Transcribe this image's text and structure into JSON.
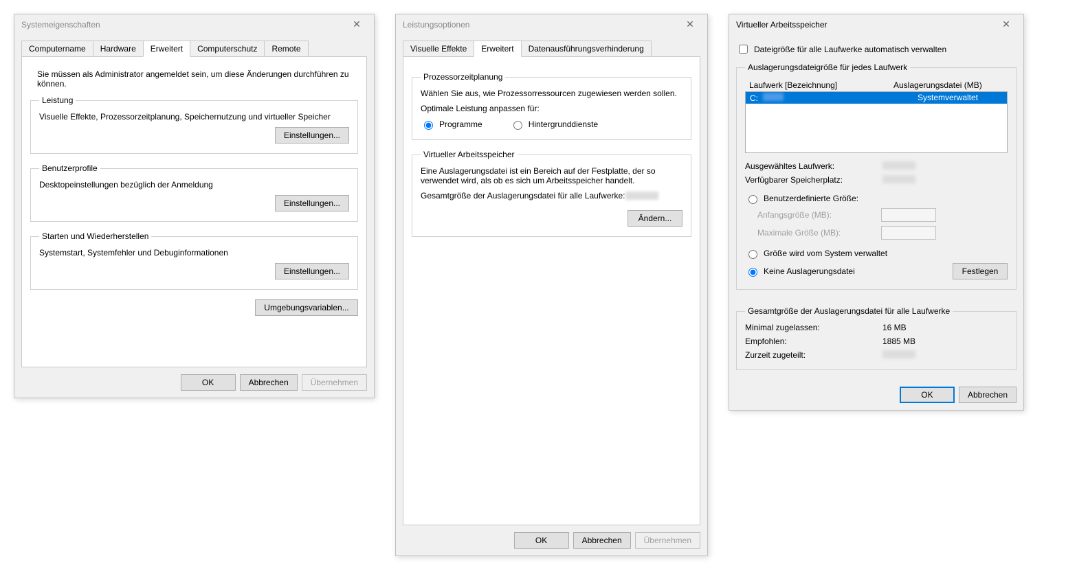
{
  "dlg1": {
    "title": "Systemeigenschaften",
    "tabs": [
      "Computername",
      "Hardware",
      "Erweitert",
      "Computerschutz",
      "Remote"
    ],
    "admin_note": "Sie müssen als Administrator angemeldet sein, um diese Änderungen durchführen zu können.",
    "g_perf": {
      "legend": "Leistung",
      "desc": "Visuelle Effekte, Prozessorzeitplanung, Speichernutzung und virtueller Speicher",
      "btn": "Einstellungen..."
    },
    "g_user": {
      "legend": "Benutzerprofile",
      "desc": "Desktopeinstellungen bezüglich der Anmeldung",
      "btn": "Einstellungen..."
    },
    "g_start": {
      "legend": "Starten und Wiederherstellen",
      "desc": "Systemstart, Systemfehler und Debuginformationen",
      "btn": "Einstellungen..."
    },
    "envvars": "Umgebungsvariablen...",
    "ok": "OK",
    "cancel": "Abbrechen",
    "apply": "Übernehmen"
  },
  "dlg2": {
    "title": "Leistungsoptionen",
    "tabs": [
      "Visuelle Effekte",
      "Erweitert",
      "Datenausführungsverhinderung"
    ],
    "g_sched": {
      "legend": "Prozessorzeitplanung",
      "desc": "Wählen Sie aus, wie Prozessorressourcen zugewiesen werden sollen.",
      "adjust": "Optimale Leistung anpassen für:",
      "opt_programs": "Programme",
      "opt_bg": "Hintergrunddienste"
    },
    "g_vm": {
      "legend": "Virtueller Arbeitsspeicher",
      "desc": "Eine Auslagerungsdatei ist ein Bereich auf der Festplatte, der so verwendet wird, als ob es sich um Arbeitsspeicher handelt.",
      "total_label": "Gesamtgröße der Auslagerungsdatei für alle Laufwerke:",
      "btn": "Ändern..."
    },
    "ok": "OK",
    "cancel": "Abbrechen",
    "apply": "Übernehmen"
  },
  "dlg3": {
    "title": "Virtueller Arbeitsspeicher",
    "auto": "Dateigröße für alle Laufwerke automatisch verwalten",
    "g_drives": {
      "legend": "Auslagerungsdateigröße für jedes Laufwerk",
      "col_drive": "Laufwerk [Bezeichnung]",
      "col_pf": "Auslagerungsdatei (MB)",
      "rows": [
        {
          "drive": "C:",
          "pf": "Systemverwaltet"
        }
      ],
      "sel_drive": "Ausgewähltes Laufwerk:",
      "free": "Verfügbarer Speicherplatz:",
      "opt_custom": "Benutzerdefinierte Größe:",
      "init": "Anfangsgröße (MB):",
      "max": "Maximale Größe (MB):",
      "opt_sys": "Größe wird vom System verwaltet",
      "opt_none": "Keine Auslagerungsdatei",
      "set": "Festlegen"
    },
    "g_total": {
      "legend": "Gesamtgröße der Auslagerungsdatei für alle Laufwerke",
      "min": "Minimal zugelassen:",
      "min_v": "16 MB",
      "rec": "Empfohlen:",
      "rec_v": "1885 MB",
      "cur": "Zurzeit zugeteilt:"
    },
    "ok": "OK",
    "cancel": "Abbrechen"
  }
}
